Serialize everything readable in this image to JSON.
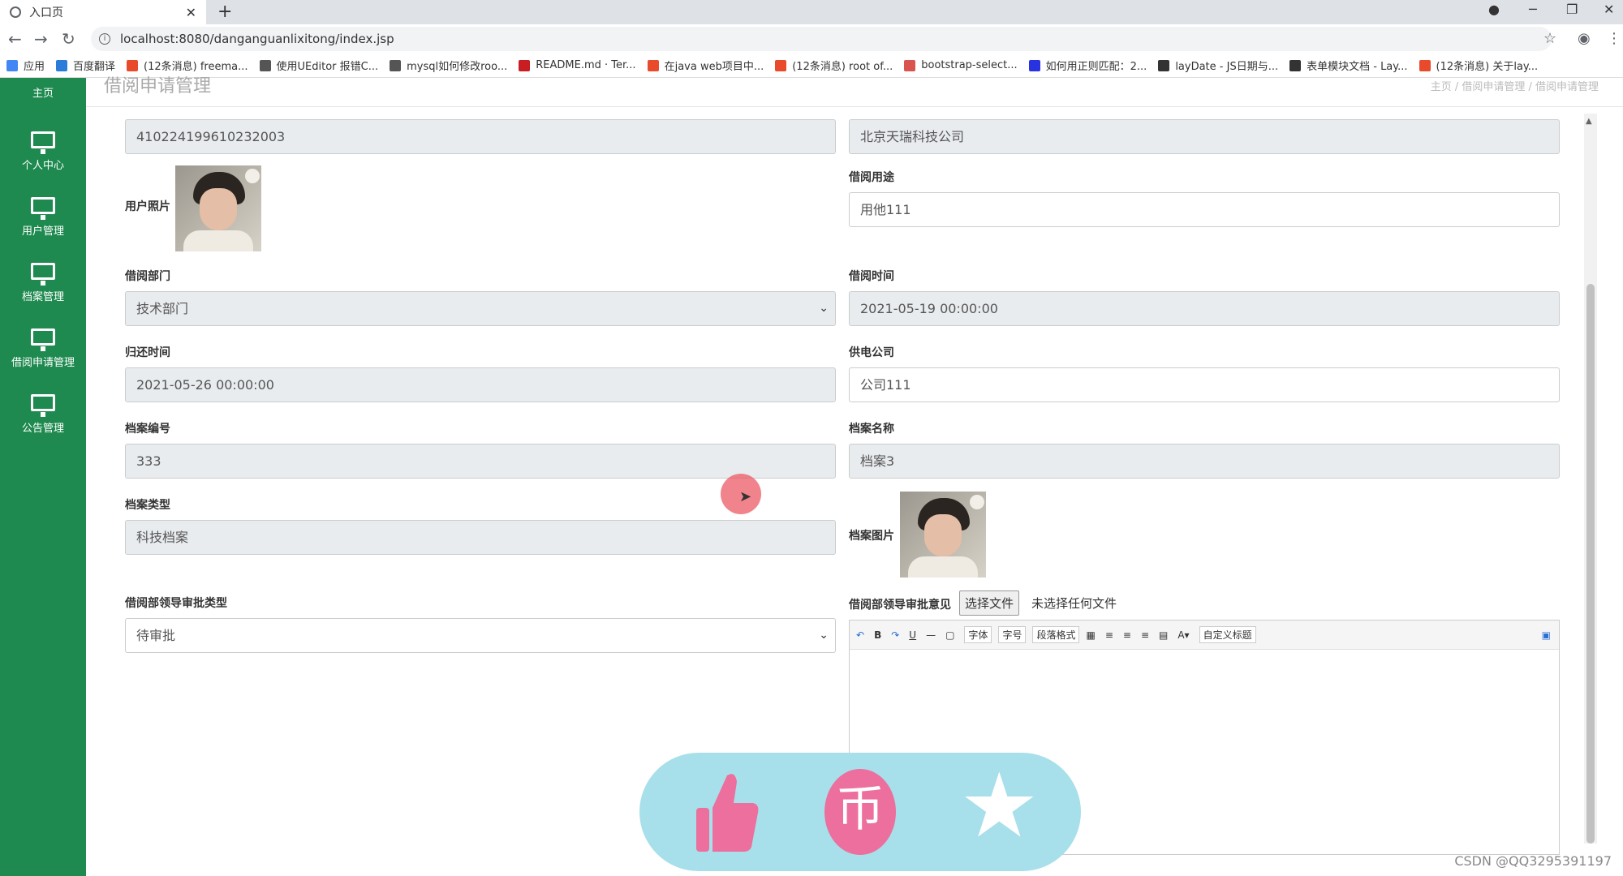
{
  "browser": {
    "tab_title": "入口页",
    "url": "localhost:8080/danganguanlixitong/index.jsp",
    "bookmarks": [
      {
        "label": "应用",
        "icon": "apps-grid-icon",
        "color": "#4285f4"
      },
      {
        "label": "百度翻译",
        "icon": "translate-icon",
        "color": "#2b7bd9"
      },
      {
        "label": "(12条消息) freema...",
        "icon": "csdn-icon",
        "color": "#e84a2b"
      },
      {
        "label": "使用UEditor 报错C...",
        "icon": "link-icon",
        "color": "#555555"
      },
      {
        "label": "mysql如何修改roo...",
        "icon": "link-icon",
        "color": "#555555"
      },
      {
        "label": "README.md · Ter...",
        "icon": "gitee-icon",
        "color": "#c71d23"
      },
      {
        "label": "在java web项目中...",
        "icon": "csdn-icon",
        "color": "#e84a2b"
      },
      {
        "label": "(12条消息) root of...",
        "icon": "csdn-icon",
        "color": "#e84a2b"
      },
      {
        "label": "bootstrap-select...",
        "icon": "page-icon",
        "color": "#d9534f"
      },
      {
        "label": "如何用正则匹配：2...",
        "icon": "baidu-icon",
        "color": "#2932e1"
      },
      {
        "label": "layDate - JS日期与...",
        "icon": "layui-icon",
        "color": "#333333"
      },
      {
        "label": "表单模块文档 - Lay...",
        "icon": "layui-icon",
        "color": "#333333"
      },
      {
        "label": "(12条消息) 关于lay...",
        "icon": "csdn-icon",
        "color": "#e84a2b"
      }
    ]
  },
  "sidebar": {
    "items": [
      {
        "label": "主页"
      },
      {
        "label": "个人中心"
      },
      {
        "label": "用户管理"
      },
      {
        "label": "档案管理"
      },
      {
        "label": "借阅申请管理"
      },
      {
        "label": "公告管理"
      }
    ]
  },
  "header": {
    "title": "借阅申请管理",
    "breadcrumb": "主页 / 借阅申请管理 / 借阅申请管理"
  },
  "form": {
    "id_number": "410224199610232003",
    "company": "北京天瑞科技公司",
    "user_photo_label": "用户照片",
    "purpose_label": "借阅用途",
    "purpose_value": "用他111",
    "department_label": "借阅部门",
    "department_value": "技术部门",
    "borrow_time_label": "借阅时间",
    "borrow_time_value": "2021-05-19 00:00:00",
    "return_time_label": "归还时间",
    "return_time_value": "2021-05-26 00:00:00",
    "supplier_label": "供电公司",
    "supplier_value": "公司111",
    "archive_no_label": "档案编号",
    "archive_no_value": "333",
    "archive_name_label": "档案名称",
    "archive_name_value": "档案3",
    "archive_type_label": "档案类型",
    "archive_type_value": "科技档案",
    "archive_image_label": "档案图片",
    "approval_type_label": "借阅部领导审批类型",
    "approval_type_value": "待审批",
    "approval_opinion_label": "借阅部领导审批意见",
    "file_button": "选择文件",
    "file_none": "未选择任何文件"
  },
  "editor": {
    "font": "字体",
    "size": "字号",
    "paragraph": "段落格式",
    "custom_title": "自定义标题"
  },
  "watermark": "CSDN @QQ3295391197",
  "colors": {
    "sidebar": "#1e8a4f",
    "overlay": "#a7dfea",
    "overlay_pink": "#ec6f9d"
  }
}
